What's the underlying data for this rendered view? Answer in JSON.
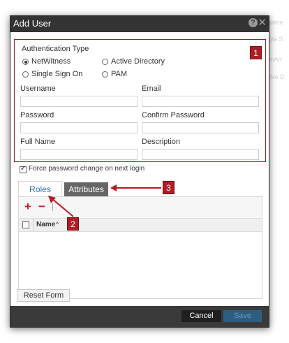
{
  "dialog": {
    "title": "Add User",
    "help_icon": "question-mark-icon",
    "close_icon": "close-x-icon"
  },
  "auth": {
    "heading": "Authentication Type",
    "options": [
      {
        "label": "NetWitness",
        "selected": true
      },
      {
        "label": "Active Directory",
        "selected": false
      },
      {
        "label": "Single Sign On",
        "selected": false
      },
      {
        "label": "PAM",
        "selected": false
      }
    ]
  },
  "fields": {
    "username": {
      "label": "Username",
      "value": ""
    },
    "email": {
      "label": "Email",
      "value": ""
    },
    "password": {
      "label": "Password",
      "value": ""
    },
    "confirm_password": {
      "label": "Confirm Password",
      "value": ""
    },
    "full_name": {
      "label": "Full Name",
      "value": ""
    },
    "description": {
      "label": "Description",
      "value": ""
    }
  },
  "force_password": {
    "label": "Force password change on next login",
    "checked": true
  },
  "tabs": [
    {
      "label": "Roles",
      "active": true
    },
    {
      "label": "Attributes",
      "active": false
    }
  ],
  "roles_toolbar": {
    "add_icon": "plus-icon",
    "remove_icon": "minus-icon",
    "edit_icon": "edit-icon"
  },
  "roles_table": {
    "columns": [
      {
        "label": "Name",
        "sort_icon": "sort-ascending-icon"
      }
    ],
    "rows": []
  },
  "buttons": {
    "reset": "Reset Form",
    "cancel": "Cancel",
    "save": "Save"
  },
  "callouts": [
    "1",
    "2",
    "3"
  ],
  "background_hint": [
    "rgame",
    "ngle S",
    "omAtt",
    "ctive D"
  ],
  "colors": {
    "accent_red": "#b01e24",
    "title_bar": "#333333",
    "tab_link": "#2f6fab",
    "save_button": "#2c5e82"
  }
}
